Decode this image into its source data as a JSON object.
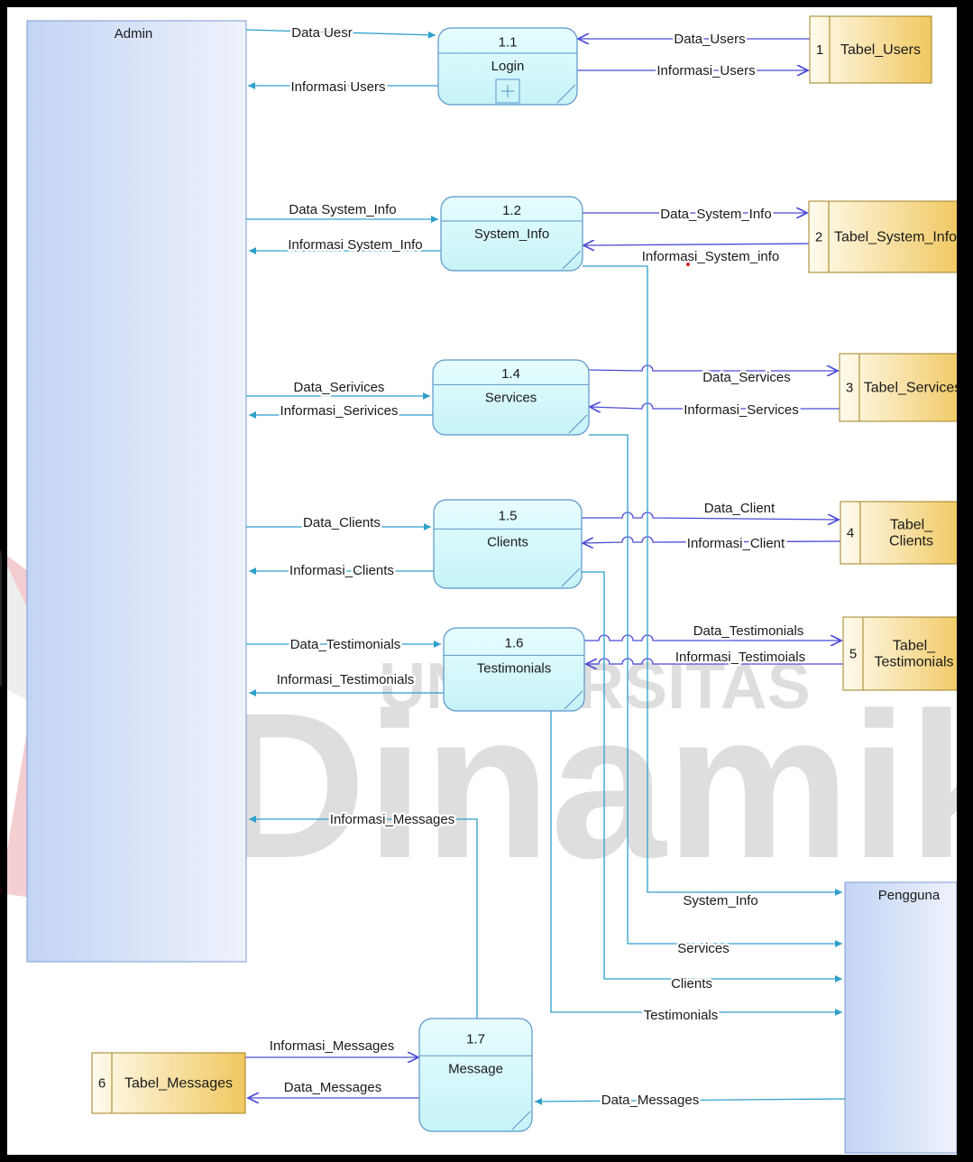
{
  "entities": {
    "admin": "Admin",
    "pengguna": "Pengguna"
  },
  "processes": [
    {
      "id": "p1",
      "number": "1.1",
      "name": "Login",
      "has_subprocess_marker": true
    },
    {
      "id": "p2",
      "number": "1.2",
      "name": "System_Info"
    },
    {
      "id": "p4",
      "number": "1.4",
      "name": "Services"
    },
    {
      "id": "p5",
      "number": "1.5",
      "name": "Clients"
    },
    {
      "id": "p6",
      "number": "1.6",
      "name": "Testimonials"
    },
    {
      "id": "p7",
      "number": "1.7",
      "name": "Message"
    }
  ],
  "datastores": [
    {
      "id": "s1",
      "number": "1",
      "name": "Tabel_Users"
    },
    {
      "id": "s2",
      "number": "2",
      "name": "Tabel_System_Info"
    },
    {
      "id": "s3",
      "number": "3",
      "name": "Tabel_Services"
    },
    {
      "id": "s4",
      "number": "4",
      "name": "Tabel_ Clients"
    },
    {
      "id": "s5",
      "number": "5",
      "name": "Tabel_ Testimonials"
    },
    {
      "id": "s6",
      "number": "6",
      "name": "Tabel_Messages"
    }
  ],
  "flows": [
    {
      "id": "f1",
      "label": "Data Uesr"
    },
    {
      "id": "f2",
      "label": "Informasi Users"
    },
    {
      "id": "f3",
      "label": "Data_Users"
    },
    {
      "id": "f4",
      "label": "Informasi_Users"
    },
    {
      "id": "f5",
      "label": "Data System_Info"
    },
    {
      "id": "f6",
      "label": "Informasi System_Info"
    },
    {
      "id": "f7",
      "label": "Data_System_Info"
    },
    {
      "id": "f8",
      "label": "Informasi_System_info"
    },
    {
      "id": "f9",
      "label": "Data_Serivices"
    },
    {
      "id": "f10",
      "label": "Informasi_Serivices"
    },
    {
      "id": "f11",
      "label": "Data_Services"
    },
    {
      "id": "f12",
      "label": "Informasi_Services"
    },
    {
      "id": "f13",
      "label": "Data_Clients"
    },
    {
      "id": "f14",
      "label": "Informasi_Clients"
    },
    {
      "id": "f15",
      "label": "Data_Client"
    },
    {
      "id": "f16",
      "label": "Informasi_Client"
    },
    {
      "id": "f17",
      "label": "Data_Testimonials"
    },
    {
      "id": "f18",
      "label": "Informasi_Testimonials"
    },
    {
      "id": "f19",
      "label": "Data_Testimonials"
    },
    {
      "id": "f20",
      "label": "Informasi_Testimoials"
    },
    {
      "id": "f21",
      "label": "Informasi_Messages"
    },
    {
      "id": "f22",
      "label": "System_Info"
    },
    {
      "id": "f23",
      "label": "Services"
    },
    {
      "id": "f24",
      "label": "Clients"
    },
    {
      "id": "f25",
      "label": "Testimonials"
    },
    {
      "id": "f26",
      "label": "Informasi_Messages"
    },
    {
      "id": "f27",
      "label": "Data_Messages"
    },
    {
      "id": "f28",
      "label": "Data_Messages"
    }
  ],
  "watermark": {
    "line1": "UNIVERSITAS",
    "line2": "Dinamika"
  },
  "colors": {
    "entity_fill": "#d5e2f7",
    "process_fill": "#d6fafc",
    "datastore_fill": "#f3d27a",
    "flow_line": "#2e9fc9",
    "store_flow_line": "#4b4bd8",
    "border": "#000000"
  }
}
